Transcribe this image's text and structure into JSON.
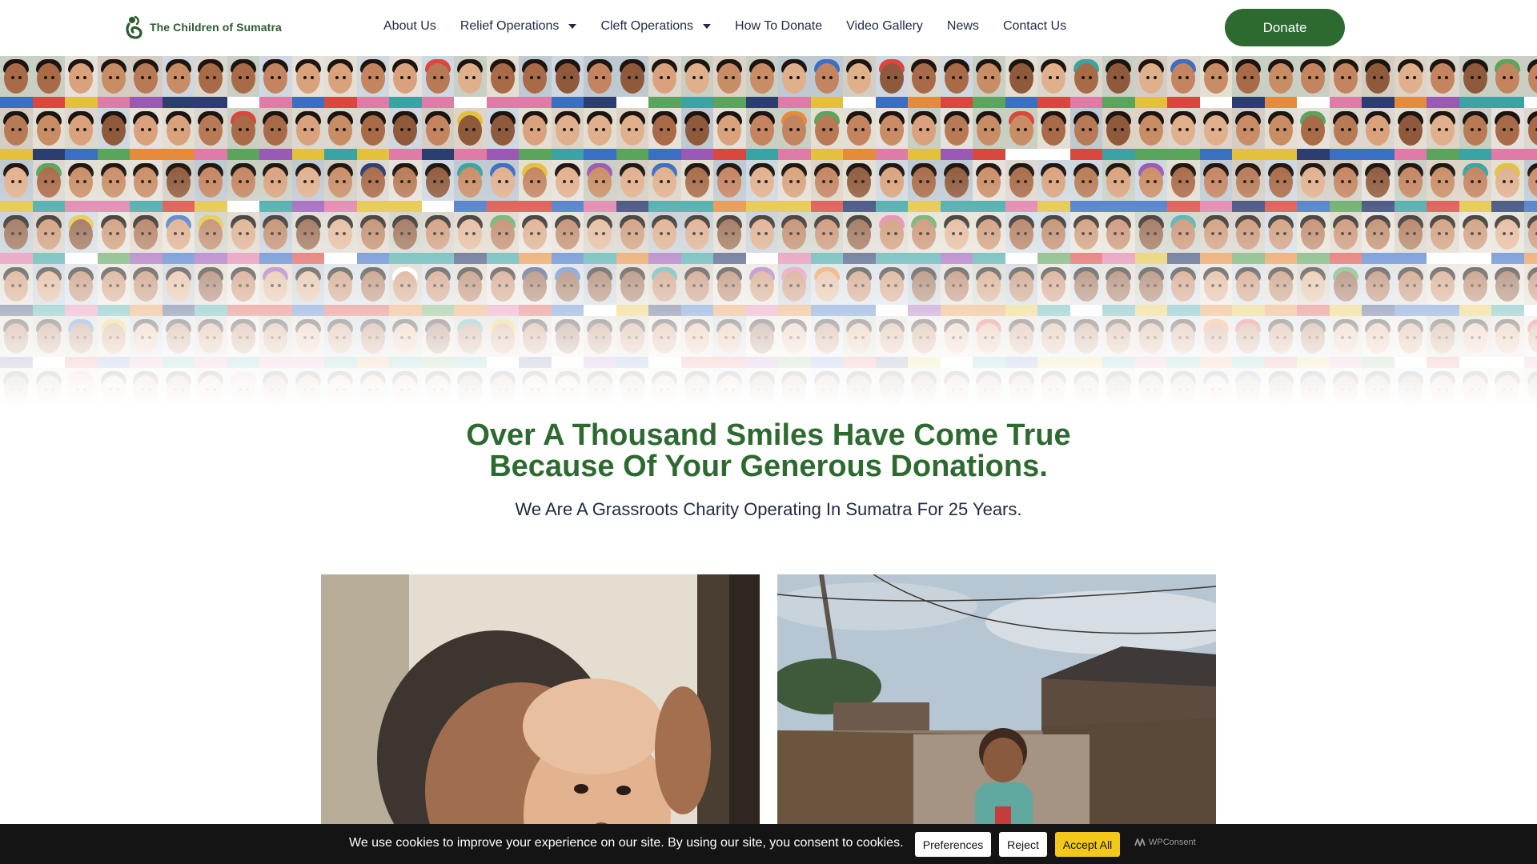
{
  "header": {
    "logo_text": "The Children of Sumatra",
    "logo_icon": "cos-logo-icon",
    "nav": [
      {
        "label": "About Us",
        "dropdown": false
      },
      {
        "label": "Relief Operations",
        "dropdown": true
      },
      {
        "label": "Cleft Operations",
        "dropdown": true
      },
      {
        "label": "How To Donate",
        "dropdown": false
      },
      {
        "label": "Video Gallery",
        "dropdown": false
      },
      {
        "label": "News",
        "dropdown": false
      },
      {
        "label": "Contact Us",
        "dropdown": false
      }
    ],
    "donate_label": "Donate"
  },
  "hero": {
    "headline_line1": "Over A Thousand Smiles Have Come True",
    "headline_line2": "Because Of Your Generous Donations.",
    "subline": "We Are A Grassroots Charity Operating In Sumatra For 25 Years."
  },
  "cookie_banner": {
    "message": "We use cookies to improve your experience on our site. By using our site, you consent to cookies.",
    "preferences_label": "Preferences",
    "reject_label": "Reject",
    "accept_label": "Accept All",
    "brand": "WPConsent"
  },
  "colors": {
    "brand_green": "#2c6a2f",
    "headline_green": "#2d6a2f",
    "text_navy": "#1f2a44",
    "cookie_bar": "#141414",
    "accept_yellow": "#f3c81b"
  }
}
